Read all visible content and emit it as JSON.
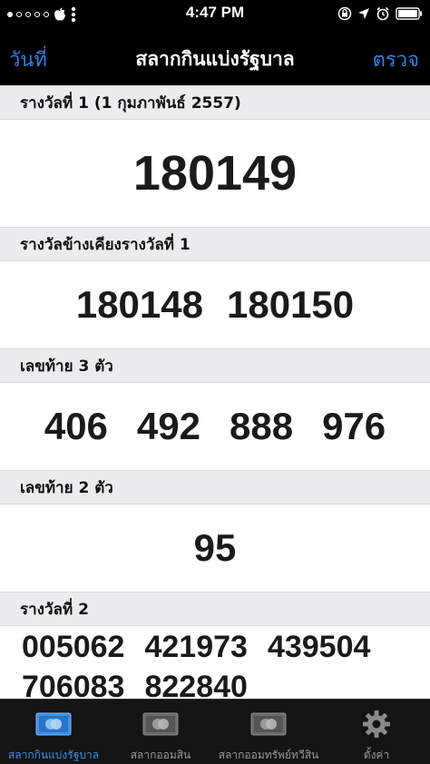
{
  "status": {
    "time": "4:47 PM"
  },
  "nav": {
    "left_label": "วันที่",
    "title": "สลากกินแบ่งรัฐบาล",
    "right_label": "ตรวจ"
  },
  "sections": {
    "first_prize": {
      "header": "รางวัลที่ 1 (1 กุมภาพันธ์ 2557)",
      "numbers": [
        "180149"
      ]
    },
    "adjacent_first": {
      "header": "รางวัลข้างเคียงรางวัลที่ 1",
      "numbers": [
        "180148",
        "180150"
      ]
    },
    "last_three": {
      "header": "เลขท้าย 3 ตัว",
      "numbers": [
        "406",
        "492",
        "888",
        "976"
      ]
    },
    "last_two": {
      "header": "เลขท้าย 2 ตัว",
      "numbers": [
        "95"
      ]
    },
    "second_prize": {
      "header": "รางวัลที่ 2",
      "numbers": [
        "005062",
        "421973",
        "439504",
        "706083",
        "822840"
      ]
    }
  },
  "tabs": [
    {
      "label": "สลากกินแบ่งรัฐบาล",
      "icon": "lottery-ticket-icon",
      "active": true
    },
    {
      "label": "สลากออมสิน",
      "icon": "savings-ticket-icon",
      "active": false
    },
    {
      "label": "สลากออมทรัพย์ทวีสิน",
      "icon": "savings-bond-ticket-icon",
      "active": false
    },
    {
      "label": "ตั้งค่า",
      "icon": "gear-icon",
      "active": false
    }
  ],
  "colors": {
    "accent": "#2f7fe0",
    "header_bg": "#ececef",
    "tab_bar_bg": "#141414"
  }
}
